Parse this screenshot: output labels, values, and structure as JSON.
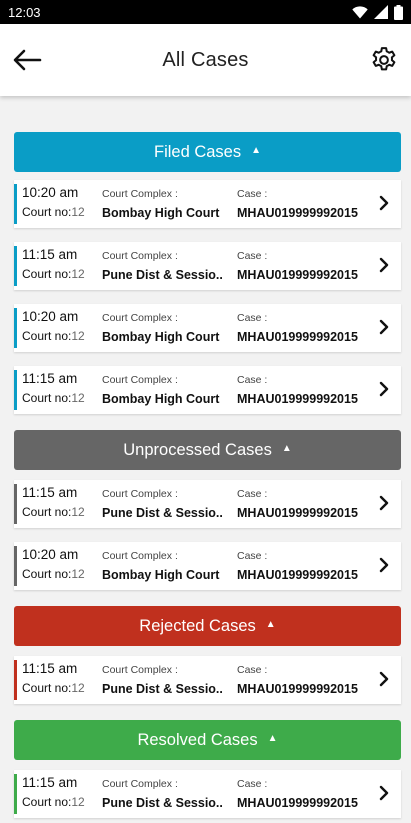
{
  "status_bar": {
    "time": "12:03"
  },
  "header": {
    "title": "All Cases"
  },
  "icons": {
    "back": "arrow-left-icon",
    "settings": "gear-icon",
    "row": "chevron-right-icon",
    "section": "chevron-up-icon"
  },
  "colors": {
    "filed": "#0a9dc6",
    "unprocessed": "#666666",
    "rejected": "#c0301e",
    "resolved": "#3eab4a"
  },
  "labels": {
    "court_no": "Court no:",
    "court_complex": "Court Complex :",
    "case": "Case :"
  },
  "sections": [
    {
      "title": "Filed Cases",
      "cases": [
        {
          "time": "10:20 am",
          "court_no": "12",
          "court_complex": "Bombay High Court",
          "case": "MHAU019999992015"
        },
        {
          "time": "11:15 am",
          "court_no": "12",
          "court_complex": "Pune Dist & Sessio..",
          "case": "MHAU019999992015"
        },
        {
          "time": "10:20 am",
          "court_no": "12",
          "court_complex": "Bombay High Court",
          "case": "MHAU019999992015"
        },
        {
          "time": "11:15 am",
          "court_no": "12",
          "court_complex": "Bombay High Court",
          "case": "MHAU019999992015"
        }
      ]
    },
    {
      "title": "Unprocessed Cases",
      "cases": [
        {
          "time": "11:15 am",
          "court_no": "12",
          "court_complex": "Pune Dist & Sessio..",
          "case": "MHAU019999992015"
        },
        {
          "time": "10:20 am",
          "court_no": "12",
          "court_complex": "Bombay High Court",
          "case": "MHAU019999992015"
        }
      ]
    },
    {
      "title": "Rejected Cases",
      "cases": [
        {
          "time": "11:15 am",
          "court_no": "12",
          "court_complex": "Pune Dist & Sessio..",
          "case": "MHAU019999992015"
        }
      ]
    },
    {
      "title": "Resolved Cases",
      "cases": [
        {
          "time": "11:15 am",
          "court_no": "12",
          "court_complex": "Pune Dist & Sessio..",
          "case": "MHAU019999992015"
        }
      ]
    }
  ]
}
